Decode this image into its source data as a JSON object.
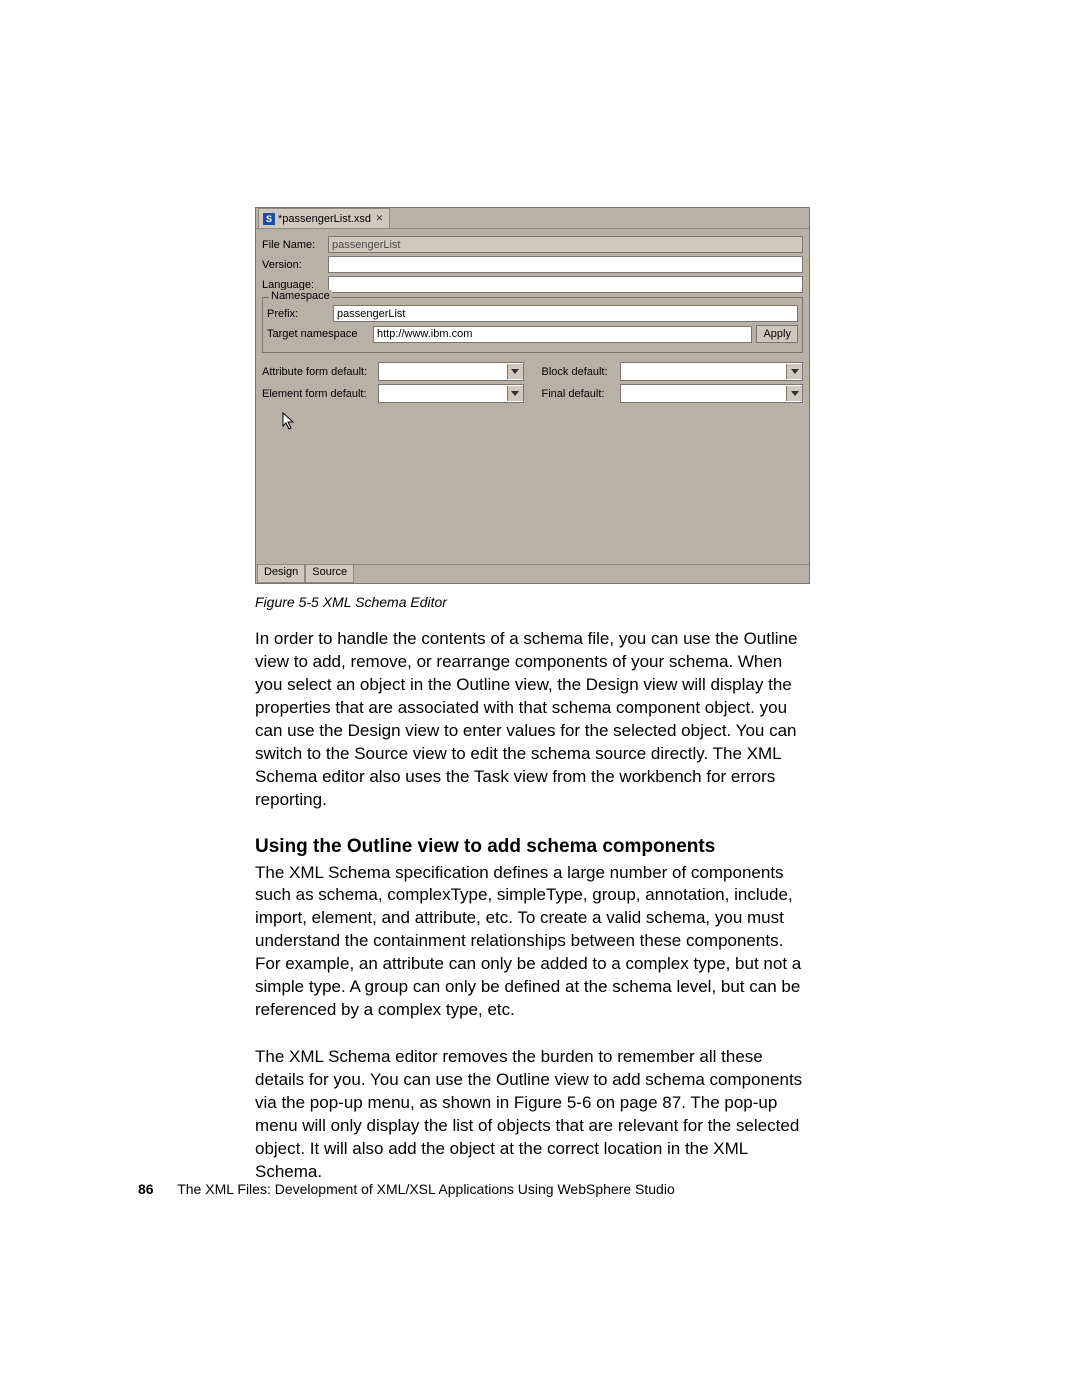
{
  "editor": {
    "tab_title": "*passengerList.xsd",
    "s_icon_label": "S",
    "labels": {
      "file_name": "File Name:",
      "version": "Version:",
      "language": "Language:",
      "namespace_legend": "Namespace",
      "prefix": "Prefix:",
      "target_ns": "Target namespace",
      "attr_form": "Attribute form default:",
      "elem_form": "Element form default:",
      "block_default": "Block default:",
      "final_default": "Final default:",
      "apply": "Apply"
    },
    "values": {
      "file_name": "passengerList",
      "prefix": "passengerList",
      "target_ns": "http://www.ibm.com"
    },
    "bottom_tabs": {
      "design": "Design",
      "source": "Source"
    }
  },
  "caption": "Figure 5-5   XML Schema Editor",
  "para1": "In order to handle the contents of a schema file, you can use the Outline view to add, remove, or rearrange components of your schema. When you select an object in the Outline view, the Design view will display the properties that are associated with that schema component object. you can use the Design view to enter values for the selected object. You can switch to the Source view to edit the schema source directly. The XML Schema editor also uses the Task view from the workbench for errors reporting.",
  "heading2": "Using the Outline view to add schema components",
  "para2": "The XML Schema specification defines a large number of components such as schema, complexType, simpleType, group, annotation, include, import, element, and attribute, etc. To create a valid schema, you must understand the containment relationships between these components. For example, an attribute can only be added to a complex type, but not a simple type. A group can only be defined at the schema level, but can be referenced by a complex type, etc.",
  "para3": "The XML Schema editor removes the burden to remember all these details for you. You can use the Outline view to add schema components via the pop-up menu, as shown in Figure 5-6 on page 87. The pop-up menu will only display the list of objects that are relevant for the selected object. It will also add the object at the correct location in the XML Schema.",
  "footer": {
    "page": "86",
    "title": "The XML Files:   Development of XML/XSL Applications Using WebSphere Studio"
  }
}
